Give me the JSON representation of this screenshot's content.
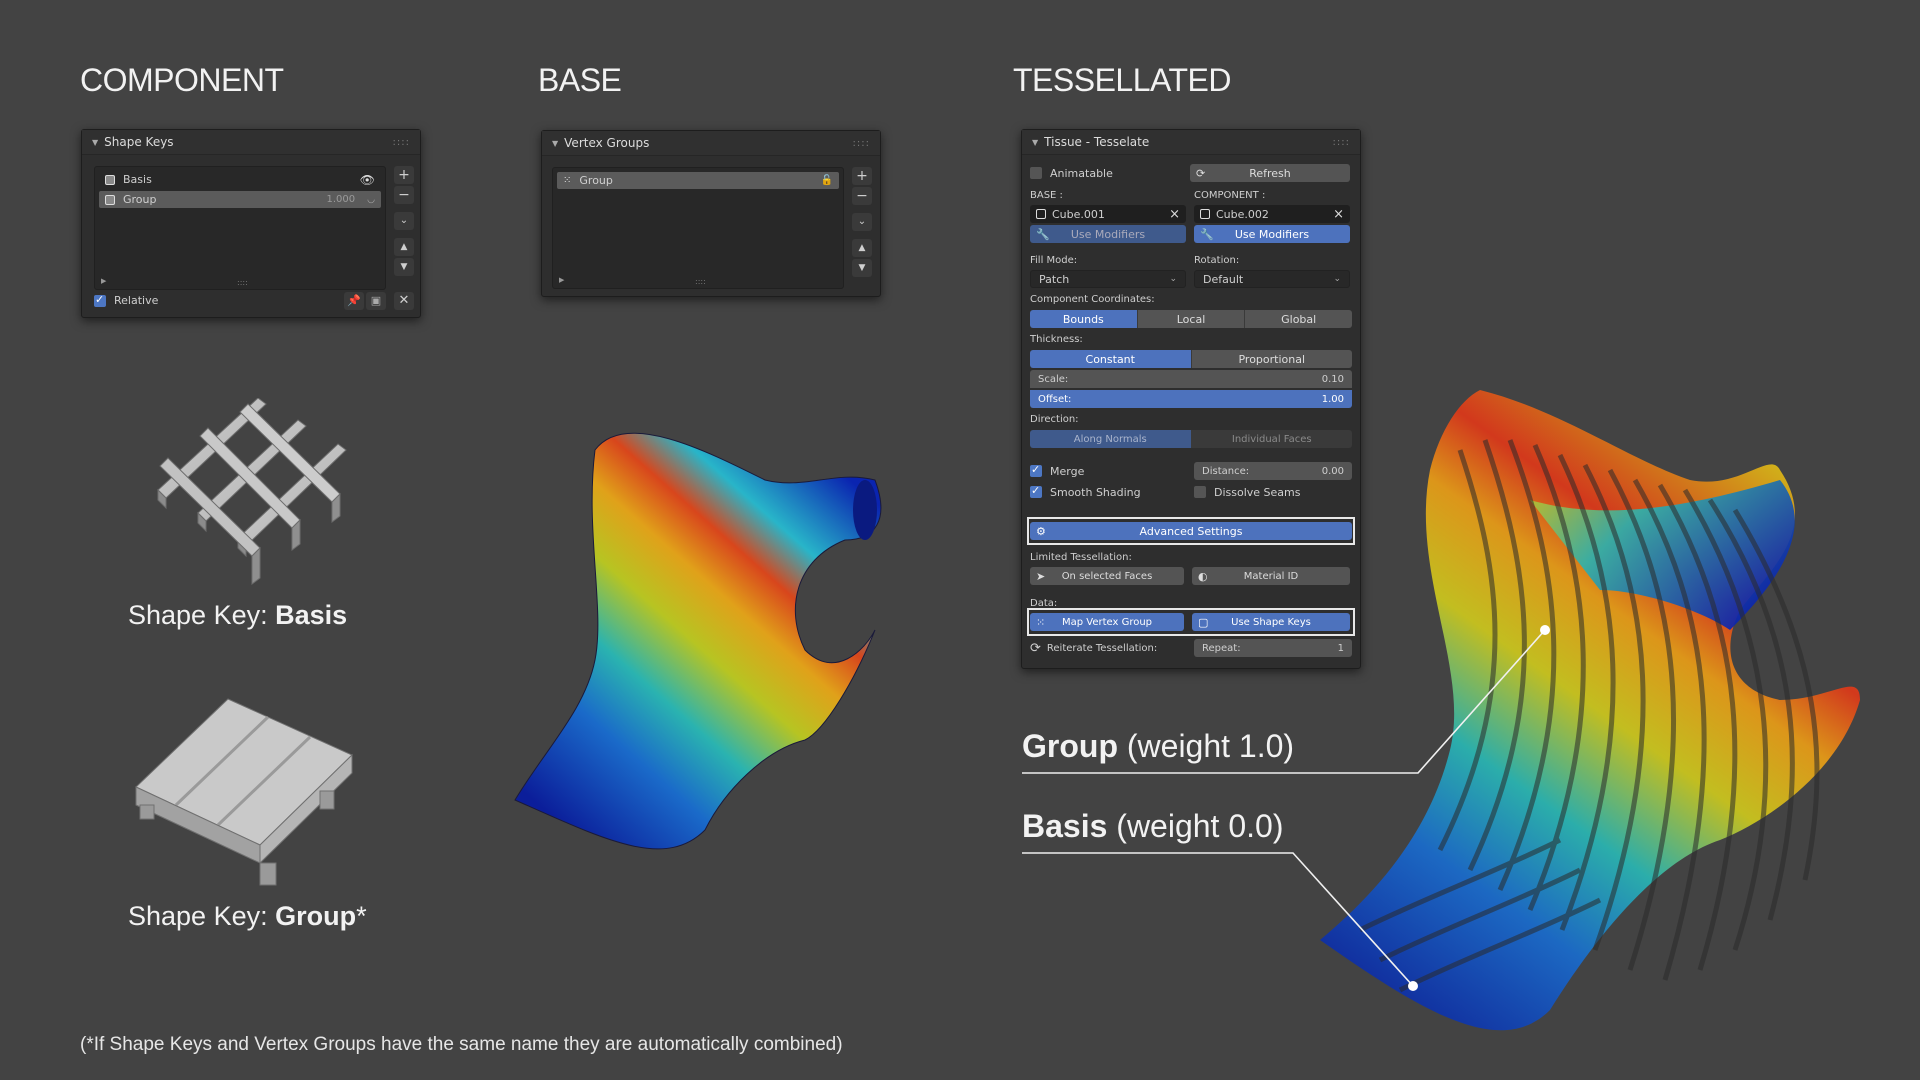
{
  "sections": {
    "component": "COMPONENT",
    "base": "BASE",
    "tessellated": "TESSELLATED"
  },
  "shape_keys_panel": {
    "title": "Shape Keys",
    "items": [
      {
        "name": "Basis",
        "value": ""
      },
      {
        "name": "Group",
        "value": "1.000"
      }
    ],
    "relative_label": "Relative"
  },
  "vertex_groups_panel": {
    "title": "Vertex Groups",
    "items": [
      {
        "name": "Group"
      }
    ]
  },
  "tissue_panel": {
    "title": "Tissue - Tesselate",
    "animatable": "Animatable",
    "refresh": "Refresh",
    "base_label": "BASE :",
    "component_label": "COMPONENT :",
    "base_object": "Cube.001",
    "component_object": "Cube.002",
    "use_modifiers": "Use Modifiers",
    "fill_mode_label": "Fill Mode:",
    "rotation_label": "Rotation:",
    "fill_mode_value": "Patch",
    "rotation_value": "Default",
    "component_coords_label": "Component Coordinates:",
    "coords": [
      "Bounds",
      "Local",
      "Global"
    ],
    "thickness_label": "Thickness:",
    "thickness_modes": [
      "Constant",
      "Proportional"
    ],
    "scale_label": "Scale:",
    "scale_value": "0.10",
    "offset_label": "Offset:",
    "offset_value": "1.00",
    "direction_label": "Direction:",
    "direction_modes": [
      "Along Normals",
      "Individual Faces"
    ],
    "merge": "Merge",
    "distance_label": "Distance:",
    "distance_value": "0.00",
    "smooth_shading": "Smooth Shading",
    "dissolve_seams": "Dissolve Seams",
    "advanced_settings": "Advanced Settings",
    "limited_label": "Limited Tessellation:",
    "on_selected_faces": "On selected Faces",
    "material_id": "Material ID",
    "data_label": "Data:",
    "map_vertex_group": "Map Vertex Group",
    "use_shape_keys": "Use Shape Keys",
    "reiterate_label": "Reiterate Tessellation:",
    "repeat_label": "Repeat:",
    "repeat_value": "1"
  },
  "captions": {
    "basis_prefix": "Shape Key: ",
    "basis_bold": "Basis",
    "group_prefix": "Shape Key: ",
    "group_bold": "Group",
    "group_suffix": "*"
  },
  "annotations": {
    "group_bold": "Group",
    "group_rest": " (weight 1.0)",
    "basis_bold": "Basis",
    "basis_rest": " (weight 0.0)"
  },
  "footnote": "(*If Shape Keys and Vertex Groups have the same name they are automatically combined)",
  "colors": {
    "background": "#434343",
    "accent_blue": "#4d72bd",
    "panel": "#2e2e2e"
  }
}
